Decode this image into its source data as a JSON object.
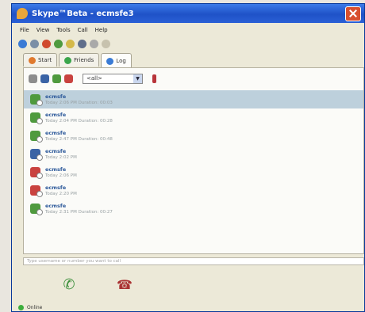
{
  "window": {
    "title": "Skype™Beta - ecmsfe3"
  },
  "menu": [
    "File",
    "View",
    "Tools",
    "Call",
    "Help"
  ],
  "toolbar_icons": [
    "contacts-icon",
    "info-icon",
    "stop-icon",
    "call-icon",
    "add-contact-icon",
    "search-icon",
    "send-icon",
    "chat-icon"
  ],
  "tabs": [
    {
      "label": "Start",
      "icon": "skype-icon",
      "color": "#e07a2e"
    },
    {
      "label": "Friends",
      "icon": "friends-icon",
      "color": "#3aa54b"
    },
    {
      "label": "Log",
      "icon": "log-icon",
      "color": "#3a7bd5",
      "active": true
    }
  ],
  "filter": {
    "selected": "<all>",
    "buttons": [
      "clear-log-icon",
      "incoming-icon",
      "outgoing-icon",
      "missed-icon"
    ]
  },
  "log_entries": [
    {
      "name": "ecmsfe",
      "detail": "Today 2:06 PM Duration: 00:03",
      "icon": "outgoing-call-icon",
      "color": "#4f9a3e"
    },
    {
      "name": "ecmsfe",
      "detail": "Today 2:04 PM Duration: 00:28",
      "icon": "outgoing-call-icon",
      "color": "#4f9a3e"
    },
    {
      "name": "ecmsfe",
      "detail": "Today 2:47 PM Duration: 00:48",
      "icon": "outgoing-call-icon",
      "color": "#4f9a3e"
    },
    {
      "name": "ecmsfe",
      "detail": "Today 2:02 PM",
      "icon": "incoming-call-icon",
      "color": "#3a63a5"
    },
    {
      "name": "ecmsfe",
      "detail": "Today 2:06 PM",
      "icon": "missed-call-icon",
      "color": "#c9423f"
    },
    {
      "name": "ecmsfe",
      "detail": "Today 2:20 PM",
      "icon": "missed-call-icon",
      "color": "#c9423f"
    },
    {
      "name": "ecmsfe",
      "detail": "Today 2:31 PM Duration: 00:27",
      "icon": "outgoing-call-icon",
      "color": "#4f9a3e"
    }
  ],
  "message_bar": {
    "placeholder": "Type username or number you want to call"
  },
  "status": {
    "label": "Online"
  }
}
